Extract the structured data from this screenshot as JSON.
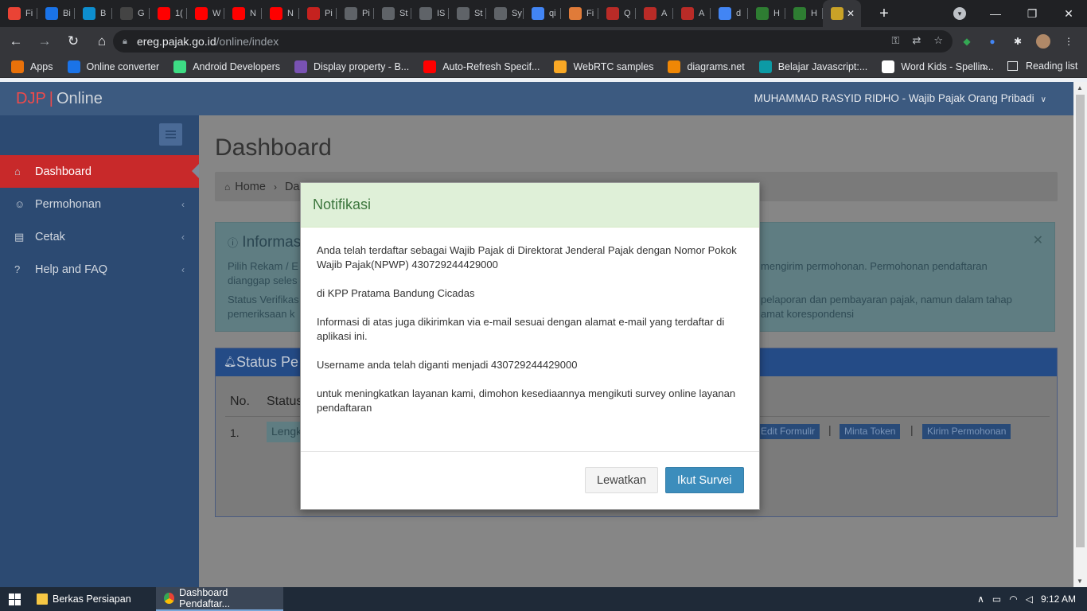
{
  "browser": {
    "tabs": [
      {
        "title": "Fi",
        "icon": "multicolor-icon",
        "color": "#ea4335"
      },
      {
        "title": "Bi",
        "icon": "bird-icon",
        "color": "#1a73e8"
      },
      {
        "title": "B",
        "icon": "q-icon",
        "color": "#0d8ecf"
      },
      {
        "title": "G",
        "icon": "w-icon",
        "color": "#444444"
      },
      {
        "title": "1(",
        "icon": "youtube-icon",
        "color": "#ff0000"
      },
      {
        "title": "W",
        "icon": "youtube-icon",
        "color": "#ff0000"
      },
      {
        "title": "N",
        "icon": "youtube-icon",
        "color": "#ff0000"
      },
      {
        "title": "N",
        "icon": "youtube-icon",
        "color": "#ff0000"
      },
      {
        "title": "Pi",
        "icon": "gmail-icon",
        "color": "#c5221f"
      },
      {
        "title": "Pi",
        "icon": "location-icon",
        "color": "#5f6368"
      },
      {
        "title": "St",
        "icon": "globe-icon",
        "color": "#5f6368"
      },
      {
        "title": "IS",
        "icon": "globe-icon",
        "color": "#5f6368"
      },
      {
        "title": "St",
        "icon": "globe-icon",
        "color": "#5f6368"
      },
      {
        "title": "Sy",
        "icon": "globe-icon",
        "color": "#5f6368"
      },
      {
        "title": "qi",
        "icon": "google-icon",
        "color": "#4285f4"
      },
      {
        "title": "Fi",
        "icon": "fox-icon",
        "color": "#e07b39"
      },
      {
        "title": "Q",
        "icon": "quora-icon",
        "color": "#b92b27"
      },
      {
        "title": "A",
        "icon": "quora-icon",
        "color": "#b92b27"
      },
      {
        "title": "A",
        "icon": "quora-icon",
        "color": "#b92b27"
      },
      {
        "title": "d",
        "icon": "google-icon",
        "color": "#4285f4"
      },
      {
        "title": "H",
        "icon": "badge-icon",
        "color": "#2e7d32"
      },
      {
        "title": "H",
        "icon": "badge-icon",
        "color": "#2e7d32"
      },
      {
        "title": "",
        "icon": "djp-icon",
        "color": "#c9a227"
      }
    ],
    "new_tab": "+",
    "window_controls": {
      "minimize": "—",
      "maximize": "❐",
      "close": "✕"
    },
    "nav": {
      "back": "←",
      "forward": "→",
      "reload": "↻",
      "home": "⌂"
    },
    "url_host": "ereg.pajak.go.id",
    "url_path": "/online/index",
    "bookmarks": [
      {
        "label": "Apps",
        "icon": "apps-grid-icon",
        "color": "#e8710a"
      },
      {
        "label": "Online converter",
        "icon": "2u-icon",
        "color": "#1a73e8"
      },
      {
        "label": "Android Developers",
        "icon": "android-icon",
        "color": "#3ddc84"
      },
      {
        "label": "Display property - B...",
        "icon": "bootstrap-icon",
        "color": "#7952b3"
      },
      {
        "label": "Auto-Refresh Specif...",
        "icon": "youtube-icon",
        "color": "#ff0000"
      },
      {
        "label": "WebRTC samples",
        "icon": "webrtc-icon",
        "color": "#f9a825"
      },
      {
        "label": "diagrams.net",
        "icon": "diagrams-icon",
        "color": "#f08705"
      },
      {
        "label": "Belajar Javascript:...",
        "icon": "dicoding-icon",
        "color": "#0c9aa5"
      },
      {
        "label": "Word Kids - Spellin...",
        "icon": "wordkids-icon",
        "color": "#ffffff"
      }
    ],
    "bookmarks_more": "»",
    "reading_list": "Reading list"
  },
  "app": {
    "logo_brand": "DJP",
    "logo_sep": "|",
    "logo_product": "Online",
    "username": "MUHAMMAD RASYID RIDHO - Wajib Pajak Orang Pribadi",
    "menu": [
      {
        "label": "Dashboard",
        "icon": "home-icon",
        "active": true
      },
      {
        "label": "Permohonan",
        "icon": "users-icon",
        "active": false
      },
      {
        "label": "Cetak",
        "icon": "print-icon",
        "active": false
      },
      {
        "label": "Help and FAQ",
        "icon": "question-icon",
        "active": false
      }
    ],
    "page_title": "Dashboard",
    "breadcrumb": {
      "home": "Home",
      "current": "Da"
    },
    "info": {
      "title": "Informas",
      "line1_left": "Pilih Rekam / E",
      "line1_right": "mengirim permohonan. Permohonan pendaftaran",
      "line2_left": "dianggap seles",
      "line3_left": "Status Verifikas",
      "line3_right": "pelaporan dan pembayaran pajak, namun dalam tahap",
      "line4_left": "pemeriksaan k",
      "line4_right": "amat korespondensi"
    },
    "status": {
      "title": "Status Pe",
      "col_no": "No.",
      "col_status": "Status",
      "row_no": "1.",
      "row_status": "Lengk",
      "actions": [
        "Edit Formulir",
        "Minta Token",
        "Kirim Permohonan"
      ]
    }
  },
  "modal": {
    "title": "Notifikasi",
    "p1": "Anda telah terdaftar sebagai Wajib Pajak di Direktorat Jenderal Pajak dengan Nomor Pokok Wajib Pajak(NPWP) 430729244429000",
    "p2": "di KPP Pratama Bandung Cicadas",
    "p3": "Informasi di atas juga dikirimkan via e-mail sesuai dengan alamat e-mail yang terdaftar di aplikasi ini.",
    "p4": "Username anda telah diganti menjadi 430729244429000",
    "p5": "untuk meningkatkan layanan kami, dimohon kesediaannya mengikuti survey online layanan pendaftaran",
    "skip_label": "Lewatkan",
    "survey_label": "Ikut Survei"
  },
  "taskbar": {
    "items": [
      {
        "label": "Berkas Persiapan",
        "icon": "folder-icon",
        "active": false
      },
      {
        "label": "Dashboard Pendaftar...",
        "icon": "chrome-icon",
        "active": true
      }
    ],
    "time": "9:12 AM"
  }
}
